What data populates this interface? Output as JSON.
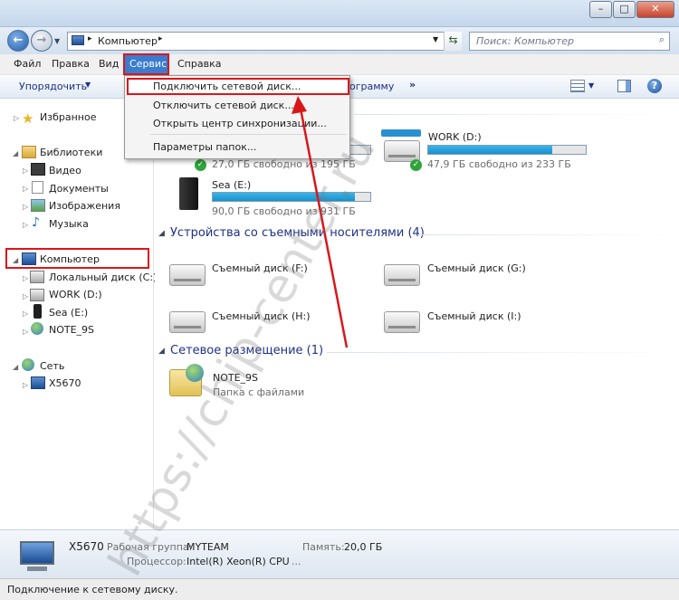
{
  "address": {
    "path": "Компьютер"
  },
  "search": {
    "placeholder": "Поиск: Компьютер"
  },
  "menu": {
    "items": [
      "Файл",
      "Правка",
      "Вид",
      "Сервис",
      "Справка"
    ]
  },
  "toolbar": {
    "organize": "Упорядочить",
    "uninstall_partial": "ограмму",
    "more": "»"
  },
  "dropdown": {
    "items": [
      "Подключить сетевой диск...",
      "Отключить сетевой диск...",
      "Открыть центр синхронизации...",
      "Параметры папок..."
    ]
  },
  "sidebar": {
    "favorites": "Избранное",
    "libraries": "Библиотеки",
    "lib_items": [
      "Видео",
      "Документы",
      "Изображения",
      "Музыка"
    ],
    "computer": "Компьютер",
    "computer_items": [
      "Локальный диск (C:)",
      "WORK (D:)",
      "Sea (E:)",
      "NOTE_9S"
    ],
    "network": "Сеть",
    "network_items": [
      "X5670"
    ]
  },
  "drives": {
    "c": {
      "free": "27,0 ГБ свободно из 195 ГБ",
      "used": 0.86
    },
    "d": {
      "name": "WORK (D:)",
      "free": "47,9 ГБ свободно из 233 ГБ",
      "used": 0.79
    },
    "e": {
      "name": "Sea (E:)",
      "free": "90,0 ГБ свободно из 931 ГБ",
      "used": 0.9
    }
  },
  "removable": {
    "title": "Устройства со съемными носителями (4)",
    "items": [
      "Съемный диск (F:)",
      "Съемный диск (G:)",
      "Съемный диск (H:)",
      "Съемный диск (I:)"
    ]
  },
  "network_section": {
    "title": "Сетевое размещение (1)",
    "item_name": "NOTE_9S",
    "item_desc": "Папка с файлами"
  },
  "details": {
    "name": "X5670",
    "workgroup_label": "Рабочая группа:",
    "workgroup": "MYTEAM",
    "memory_label": "Память:",
    "memory": "20,0 ГБ",
    "cpu_label": "Процессор:",
    "cpu": "Intel(R) Xeon(R) CPU",
    "cpu_cont": "..."
  },
  "status": {
    "text": "Подключение к сетевому диску."
  },
  "watermark": {
    "text": "https://chip-center.ru"
  },
  "colors": {
    "highlight_red": "#d8171b",
    "bar_blue": "#26a3dc",
    "group_title": "#1e3287",
    "menu_selected": "#3b7ccf"
  }
}
